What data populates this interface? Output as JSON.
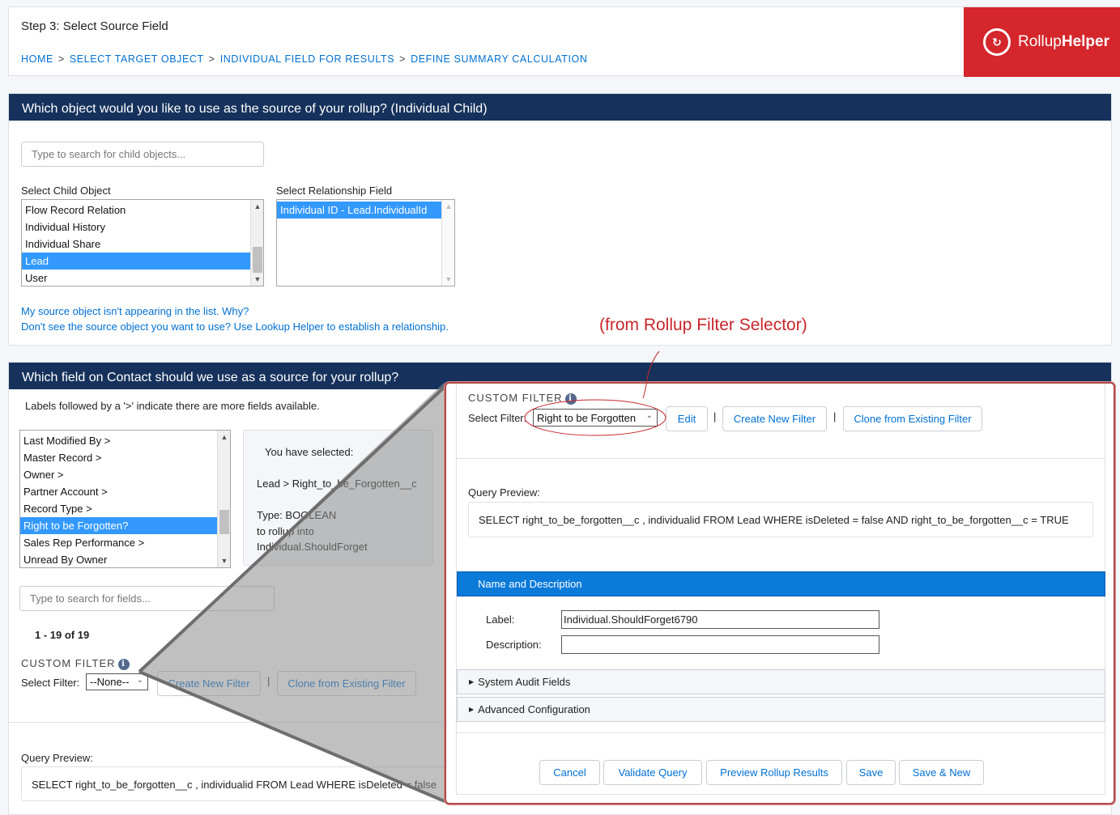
{
  "header": {
    "title": "Step 3: Select Source Field",
    "breadcrumb": [
      "HOME",
      "SELECT TARGET OBJECT",
      "INDIVIDUAL FIELD FOR RESULTS",
      "DEFINE SUMMARY CALCULATION"
    ],
    "breadcrumb_separator": ">",
    "logo_text_light": "Rollup",
    "logo_text_bold": "Helper"
  },
  "section1": {
    "heading": "Which object would you like to use as the source of your rollup? (Individual Child)",
    "search_placeholder": "Type to search for child objects...",
    "child_label": "Select Child Object",
    "child_options": [
      "Flow Record Relation",
      "Individual History",
      "Individual Share",
      "Lead",
      "User"
    ],
    "child_selected": "Lead",
    "relationship_label": "Select Relationship Field",
    "relationship_options": [
      "Individual ID - Lead.IndividualId"
    ],
    "help_link_1": "My source object isn't appearing in the list. Why?",
    "help_link_2": "Don't see the source object you want to use? Use Lookup Helper to establish a relationship."
  },
  "section2": {
    "heading": "Which field on Contact should we use as a source for your rollup?",
    "hint": "Labels followed by a '>' indicate there are more fields available.",
    "field_options": [
      "Last Modified By >",
      "Master Record >",
      "Owner >",
      "Partner Account >",
      "Record Type >",
      "Right to be Forgotten?",
      "Sales Rep Performance >",
      "Unread By Owner"
    ],
    "field_selected": "Right to be Forgotten?",
    "selected_title": "You have selected:",
    "selected_path": "Lead > Right_to_be_Forgotten__c",
    "selected_type": "Type: BOOLEAN",
    "selected_into_1": "to rollup into",
    "selected_into_2": "Individual.ShouldForget",
    "field_search_placeholder": "Type to search for fields...",
    "pagination": "1 - 19 of 19",
    "custom_filter_label": "CUSTOM FILTER",
    "select_filter_label": "Select Filter:",
    "filter_value": "--None--",
    "create_filter_button": "Create New Filter",
    "clone_filter_button": "Clone from Existing Filter",
    "pipe": "|",
    "query_label": "Query Preview:",
    "query_text": "SELECT right_to_be_forgotten__c , individualid FROM Lead WHERE isDeleted = false"
  },
  "annotation": "(from Rollup Filter Selector)",
  "popup": {
    "custom_filter_label": "CUSTOM FILTER",
    "select_filter_label": "Select Filter:",
    "filter_value": "Right to be Forgotten",
    "edit_button": "Edit",
    "create_filter_button": "Create New Filter",
    "clone_filter_button": "Clone from Existing Filter",
    "pipe": "|",
    "query_label": "Query Preview:",
    "query_text": "SELECT right_to_be_forgotten__c , individualid FROM Lead WHERE isDeleted = false AND right_to_be_forgotten__c = TRUE",
    "name_desc_heading": "Name and Description",
    "label_label": "Label:",
    "label_value": "Individual.ShouldForget6790",
    "description_label": "Description:",
    "description_value": "",
    "system_audit": "System Audit Fields",
    "advanced_config": "Advanced Configuration",
    "buttons": {
      "cancel": "Cancel",
      "validate": "Validate Query",
      "preview": "Preview Rollup Results",
      "save": "Save",
      "save_new": "Save & New"
    }
  },
  "colors": {
    "navy": "#16325c",
    "link": "#0070d2",
    "brand_red": "#d4262b",
    "select_blue": "#3399ff",
    "panel_blue": "#0b7ad9",
    "annotation_red": "#c8262b"
  }
}
